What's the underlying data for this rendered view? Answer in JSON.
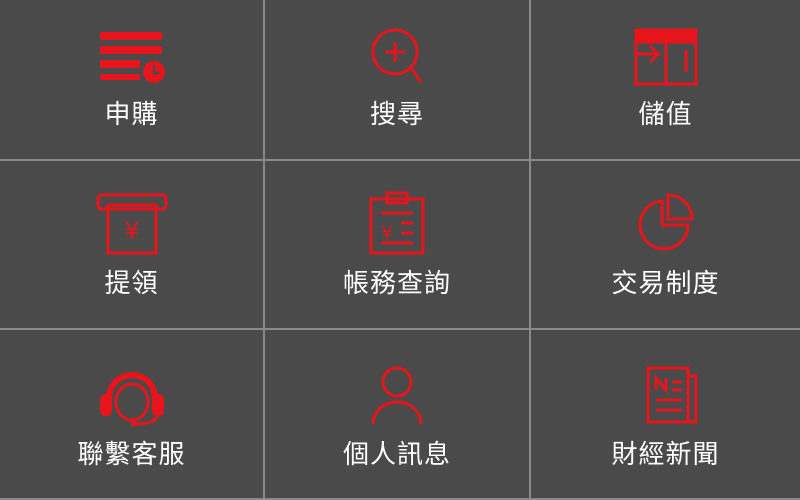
{
  "menu": {
    "accent_color": "#e8141c",
    "background_color": "#4a4a4a",
    "items": [
      {
        "label": "申購",
        "icon": "card-list-icon"
      },
      {
        "label": "搜尋",
        "icon": "search-plus-icon"
      },
      {
        "label": "儲值",
        "icon": "wallet-icon"
      },
      {
        "label": "提領",
        "icon": "atm-yen-icon"
      },
      {
        "label": "帳務查詢",
        "icon": "clipboard-yen-icon"
      },
      {
        "label": "交易制度",
        "icon": "pie-chart-icon"
      },
      {
        "label": "聯繫客服",
        "icon": "customer-service-headset-icon"
      },
      {
        "label": "個人訊息",
        "icon": "user-profile-icon"
      },
      {
        "label": "財經新聞",
        "icon": "news-document-icon"
      }
    ]
  }
}
